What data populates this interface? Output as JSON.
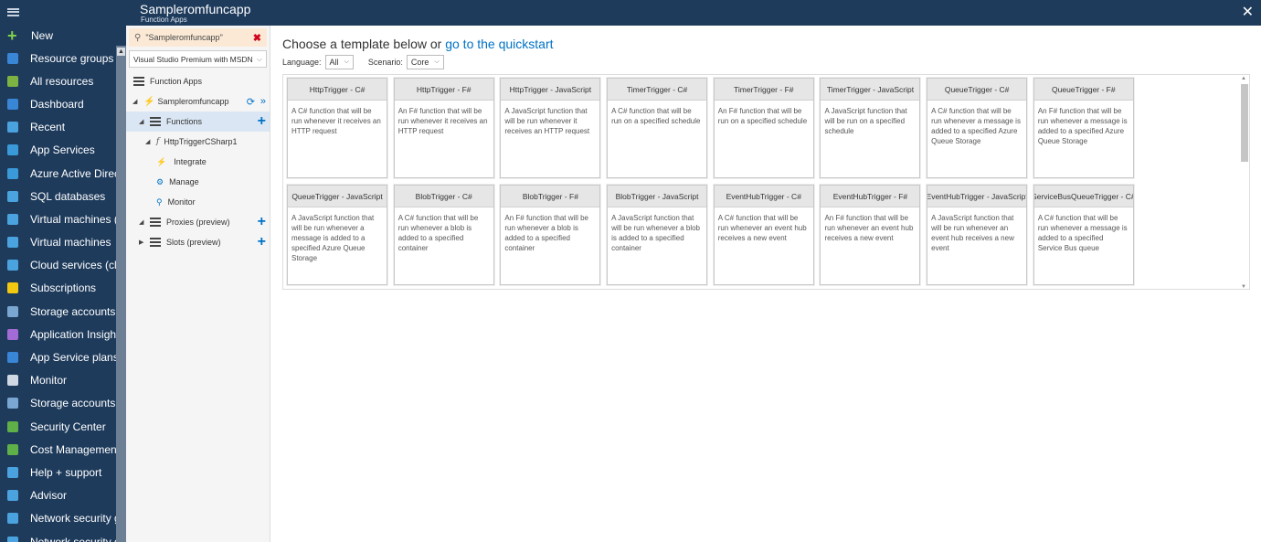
{
  "topbar": {
    "title": "Sampleromfuncapp",
    "subtitle": "Function Apps"
  },
  "leftnav": {
    "new_label": "New",
    "items": [
      {
        "label": "Resource groups",
        "icon": "resource-groups-icon",
        "color": "#3a86d6"
      },
      {
        "label": "All resources",
        "icon": "all-resources-icon",
        "color": "#7cb342"
      },
      {
        "label": "Dashboard",
        "icon": "dashboard-icon",
        "color": "#3a86d6"
      },
      {
        "label": "Recent",
        "icon": "recent-icon",
        "color": "#4aa3df"
      },
      {
        "label": "App Services",
        "icon": "app-services-icon",
        "color": "#3a9ad9"
      },
      {
        "label": "Azure Active Directory",
        "icon": "azure-ad-icon",
        "color": "#3a9ad9"
      },
      {
        "label": "SQL databases",
        "icon": "sql-databases-icon",
        "color": "#4aa3df"
      },
      {
        "label": "Virtual machines (class...",
        "icon": "virtual-machines-classic-icon",
        "color": "#4aa3df"
      },
      {
        "label": "Virtual machines",
        "icon": "virtual-machines-icon",
        "color": "#4aa3df"
      },
      {
        "label": "Cloud services (classic)",
        "icon": "cloud-services-icon",
        "color": "#4aa3df"
      },
      {
        "label": "Subscriptions",
        "icon": "subscriptions-icon",
        "color": "#f2c811"
      },
      {
        "label": "Storage accounts",
        "icon": "storage-accounts-icon",
        "color": "#7aa7d1"
      },
      {
        "label": "Application Insights",
        "icon": "application-insights-icon",
        "color": "#a36bd6"
      },
      {
        "label": "App Service plans",
        "icon": "app-service-plans-icon",
        "color": "#3a86d6"
      },
      {
        "label": "Monitor",
        "icon": "monitor-icon",
        "color": "#cfd8e3"
      },
      {
        "label": "Storage accounts (clas...",
        "icon": "storage-accounts-classic-icon",
        "color": "#7aa7d1"
      },
      {
        "label": "Security Center",
        "icon": "security-center-icon",
        "color": "#5fb048"
      },
      {
        "label": "Cost Management + B...",
        "icon": "cost-management-icon",
        "color": "#5fb048"
      },
      {
        "label": "Help + support",
        "icon": "help-support-icon",
        "color": "#4aa3df"
      },
      {
        "label": "Advisor",
        "icon": "advisor-icon",
        "color": "#4aa3df"
      },
      {
        "label": "Network security groups",
        "icon": "network-security-groups-icon",
        "color": "#4aa3df"
      },
      {
        "label": "Network security grou...",
        "icon": "network-security-groups-icon",
        "color": "#4aa3df"
      }
    ]
  },
  "panel": {
    "search_value": "\"Sampleromfuncapp\"",
    "subscription": "Visual Studio Premium with MSDN",
    "function_apps_label": "Function Apps",
    "app_name": "Sampleromfuncapp",
    "functions_label": "Functions",
    "function_name": "HttpTriggerCSharp1",
    "integrate_label": "Integrate",
    "manage_label": "Manage",
    "monitor_label": "Monitor",
    "proxies_label": "Proxies (preview)",
    "slots_label": "Slots (preview)"
  },
  "main": {
    "heading_prefix": "Choose a template below or ",
    "heading_link": "go to the quickstart",
    "language_label": "Language:",
    "language_value": "All",
    "scenario_label": "Scenario:",
    "scenario_value": "Core",
    "templates": [
      {
        "title": "HttpTrigger - C#",
        "desc": "A C# function that will be run whenever it receives an HTTP request"
      },
      {
        "title": "HttpTrigger - F#",
        "desc": "An F# function that will be run whenever it receives an HTTP request"
      },
      {
        "title": "HttpTrigger - JavaScript",
        "desc": "A JavaScript function that will be run whenever it receives an HTTP request"
      },
      {
        "title": "TimerTrigger - C#",
        "desc": "A C# function that will be run on a specified schedule"
      },
      {
        "title": "TimerTrigger - F#",
        "desc": "An F# function that will be run on a specified schedule"
      },
      {
        "title": "TimerTrigger - JavaScript",
        "desc": "A JavaScript function that will be run on a specified schedule"
      },
      {
        "title": "QueueTrigger - C#",
        "desc": "A C# function that will be run whenever a message is added to a specified Azure Queue Storage"
      },
      {
        "title": "QueueTrigger - F#",
        "desc": "An F# function that will be run whenever a message is added to a specified Azure Queue Storage"
      },
      {
        "title": "QueueTrigger - JavaScript",
        "desc": "A JavaScript function that will be run whenever a message is added to a specified Azure Queue Storage"
      },
      {
        "title": "BlobTrigger - C#",
        "desc": "A C# function that will be run whenever a blob is added to a specified container"
      },
      {
        "title": "BlobTrigger - F#",
        "desc": "An F# function that will be run whenever a blob is added to a specified container"
      },
      {
        "title": "BlobTrigger - JavaScript",
        "desc": "A JavaScript function that will be run whenever a blob is added to a specified container"
      },
      {
        "title": "EventHubTrigger - C#",
        "desc": "A C# function that will be run whenever an event hub receives a new event"
      },
      {
        "title": "EventHubTrigger - F#",
        "desc": "An F# function that will be run whenever an event hub receives a new event"
      },
      {
        "title": "EventHubTrigger - JavaScript",
        "desc": "A JavaScript function that will be run whenever an event hub receives a new event"
      },
      {
        "title": "ServiceBusQueueTrigger - C#",
        "desc": "A C# function that will be run whenever a message is added to a specified Service Bus queue"
      }
    ]
  }
}
